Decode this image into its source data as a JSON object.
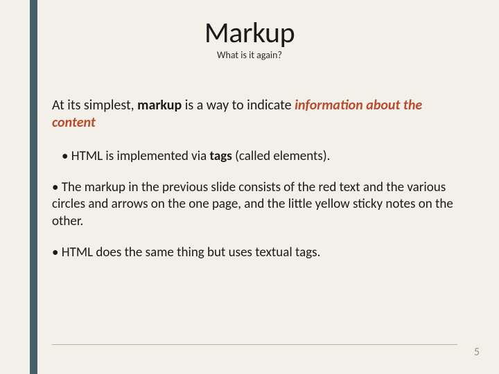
{
  "header": {
    "title": "Markup",
    "subtitle": "What is it again?"
  },
  "content": {
    "intro_pre": "At its simplest, ",
    "intro_bold": "markup",
    "intro_mid": " is a way to indicate ",
    "intro_emph": "information about the content",
    "b1_pre": "• HTML is implemented via ",
    "b1_bold": "tags",
    "b1_post": " (called elements).",
    "b2": "• The markup in the previous slide consists of the red text and the various circles and arrows on the one page, and the little yellow sticky notes on the other.",
    "b3": "• HTML does the same thing but uses textual tags."
  },
  "footer": {
    "page": "5"
  }
}
